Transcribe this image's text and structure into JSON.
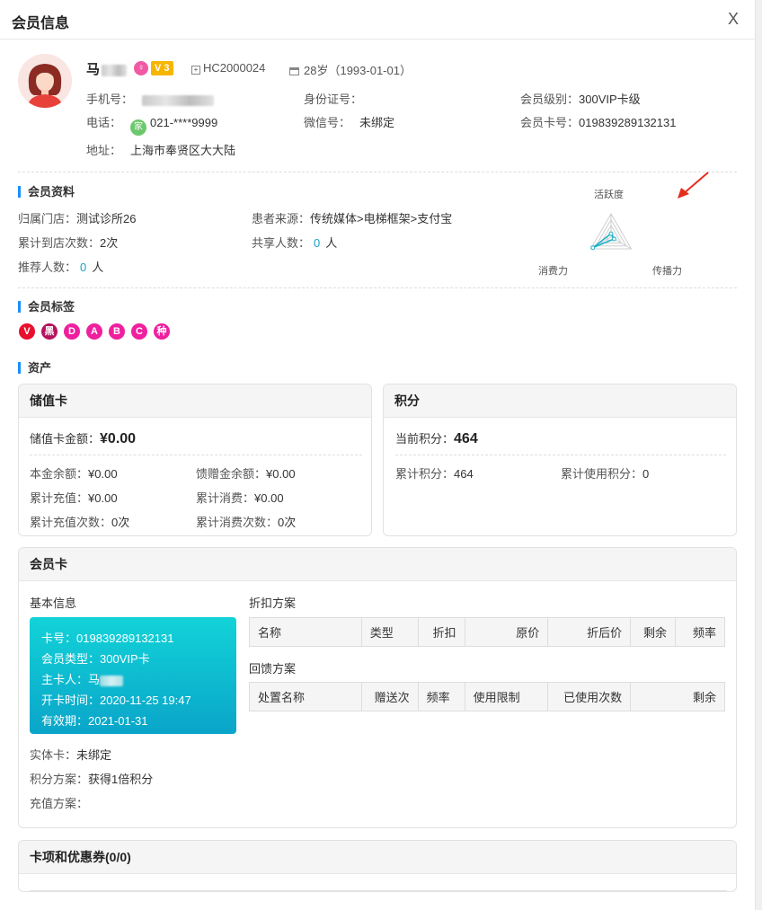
{
  "modal": {
    "title": "会员信息",
    "close_label": "X"
  },
  "profile": {
    "name": "马",
    "badge_pink": "♀",
    "vip_badge": "V 3",
    "member_code": "HC2000024",
    "age": "28岁（1993-01-01）",
    "mobile_label": "手机号：",
    "id_card_label": "身份证号：",
    "level_label": "会员级别：",
    "level_value": "300VIP卡级",
    "phone_label": "电话：",
    "home_badge": "家",
    "phone_value": "021-****9999",
    "wechat_label": "微信号：",
    "wechat_value": "未绑定",
    "card_no_label": "会员卡号：",
    "card_no_value": "019839289132131",
    "address_label": "地址：",
    "address_value": "上海市奉贤区大大陆"
  },
  "member_info": {
    "title": "会员资料",
    "store_label": "归属门店：",
    "store_value": "测试诊所26",
    "source_label": "患者来源：",
    "source_value": "传统媒体>电梯框架>支付宝",
    "visits_label": "累计到店次数：",
    "visits_value": "2次",
    "shared_label": "共享人数：",
    "shared_value": "0",
    "shared_unit": "人",
    "referral_label": "推荐人数：",
    "referral_value": "0",
    "referral_unit": "人"
  },
  "radar": {
    "labels": [
      "活跃度",
      "消费力",
      "传播力"
    ],
    "values": [
      0.15,
      0.9,
      0.15
    ],
    "color": "#1ab0c8"
  },
  "tags": {
    "title": "会员标签",
    "items": [
      {
        "text": "V",
        "color": "#e8112d"
      },
      {
        "text": "黑",
        "color": "#b5125e"
      },
      {
        "text": "D",
        "color": "#ef1f9e"
      },
      {
        "text": "A",
        "color": "#ef1f9e"
      },
      {
        "text": "B",
        "color": "#ef1f9e"
      },
      {
        "text": "C",
        "color": "#ef1f9e"
      },
      {
        "text": "种",
        "color": "#ef1f9e"
      }
    ]
  },
  "assets": {
    "title": "资产",
    "stored_card": {
      "title": "储值卡",
      "amount_label": "储值卡金额：",
      "amount_value": "¥0.00",
      "principal_label": "本金余额：",
      "principal_value": "¥0.00",
      "gift_label": "馈赠金余额：",
      "gift_value": "¥0.00",
      "recharge_label": "累计充值：",
      "recharge_value": "¥0.00",
      "consume_label": "累计消费：",
      "consume_value": "¥0.00",
      "recharge_times_label": "累计充值次数：",
      "recharge_times_value": "0次",
      "consume_times_label": "累计消费次数：",
      "consume_times_value": "0次"
    },
    "points": {
      "title": "积分",
      "current_label": "当前积分：",
      "current_value": "464",
      "total_label": "累计积分：",
      "total_value": "464",
      "used_label": "累计使用积分：",
      "used_value": "0"
    }
  },
  "member_card": {
    "title": "会员卡",
    "basic_title": "基本信息",
    "card_no_label": "卡号：",
    "card_no_value": "019839289132131",
    "type_label": "会员类型：",
    "type_value": "300VIP卡",
    "holder_label": "主卡人：",
    "holder_value": "马",
    "open_label": "开卡时间：",
    "open_value": "2020-11-25 19:47",
    "valid_label": "有效期：",
    "valid_value": "2021-01-31",
    "physical_label": "实体卡：",
    "physical_value": "未绑定",
    "points_plan_label": "积分方案：",
    "points_plan_value": "获得1倍积分",
    "recharge_plan_label": "充值方案：",
    "discount_title": "折扣方案",
    "discount_columns": [
      "名称",
      "类型",
      "折扣",
      "原价",
      "折后价",
      "剩余",
      "频率"
    ],
    "gift_title": "回馈方案",
    "gift_columns": [
      "处置名称",
      "赠送次",
      "频率",
      "使用限制",
      "已使用次数",
      "剩余"
    ]
  },
  "coupons": {
    "title": "卡项和优惠券(0/0)"
  }
}
